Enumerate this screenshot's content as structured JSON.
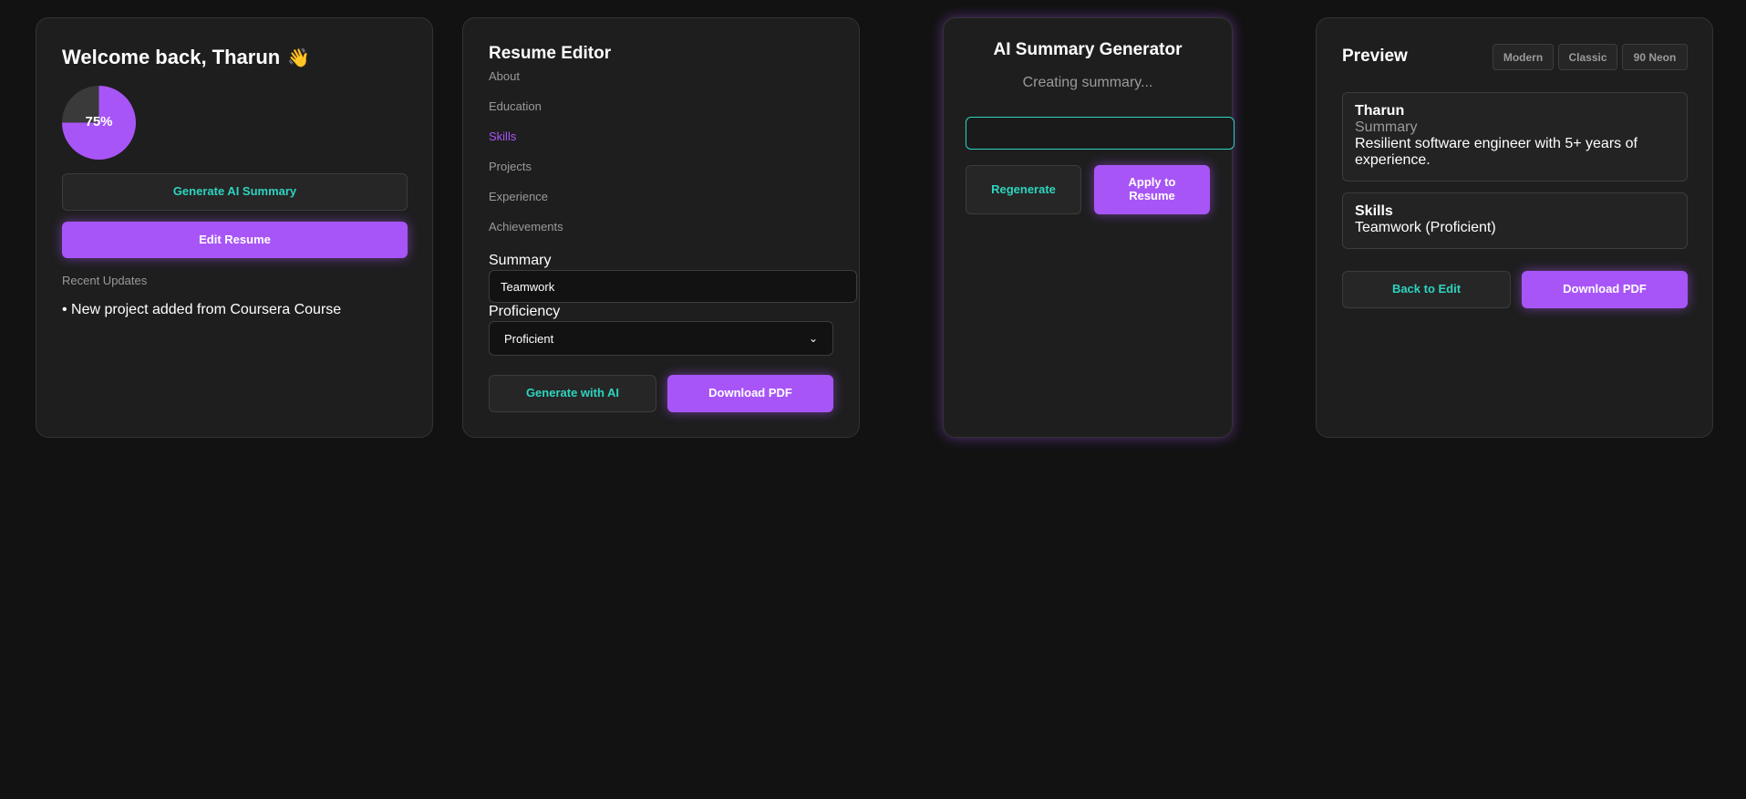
{
  "dashboard": {
    "welcome_title": "Welcome back, Tharun",
    "wave_emoji": "👋",
    "progress": 75,
    "progress_label": "75%",
    "generate_ai_summary_label": "Generate AI Summary",
    "edit_resume_label": "Edit Resume",
    "recent_updates_label": "Recent Updates",
    "recent_updates": [
      "• New project added from Coursera Course"
    ]
  },
  "editor": {
    "title": "Resume Editor",
    "nav_items": [
      {
        "label": "About",
        "active": false
      },
      {
        "label": "Education",
        "active": false
      },
      {
        "label": "Skills",
        "active": true
      },
      {
        "label": "Projects",
        "active": false
      },
      {
        "label": "Experience",
        "active": false
      },
      {
        "label": "Achievements",
        "active": false
      }
    ],
    "summary_label": "Summary",
    "summary_value": "Teamwork",
    "proficiency_label": "Proficiency",
    "proficiency_value": "Proficient",
    "generate_with_ai_label": "Generate with AI",
    "download_pdf_label": "Download PDF"
  },
  "ai_generator": {
    "title": "AI Summary Generator",
    "status": "Creating summary...",
    "input_value": "",
    "regenerate_label": "Regenerate",
    "apply_label": "Apply to Resume"
  },
  "preview": {
    "title": "Preview",
    "themes": [
      "Modern",
      "Classic",
      "90 Neon"
    ],
    "name": "Tharun",
    "summary_heading": "Summary",
    "summary_text": "Resilient software engineer with 5+ years of experience.",
    "skills_heading": "Skills",
    "skills_text": "Teamwork (Proficient)",
    "back_to_edit_label": "Back to Edit",
    "download_pdf_label": "Download PDF"
  },
  "colors": {
    "background": "#121212",
    "card": "#1e1e1e",
    "accent_purple": "#a855f7",
    "accent_teal": "#2dd4bf",
    "muted_text": "#9a9a9a"
  }
}
